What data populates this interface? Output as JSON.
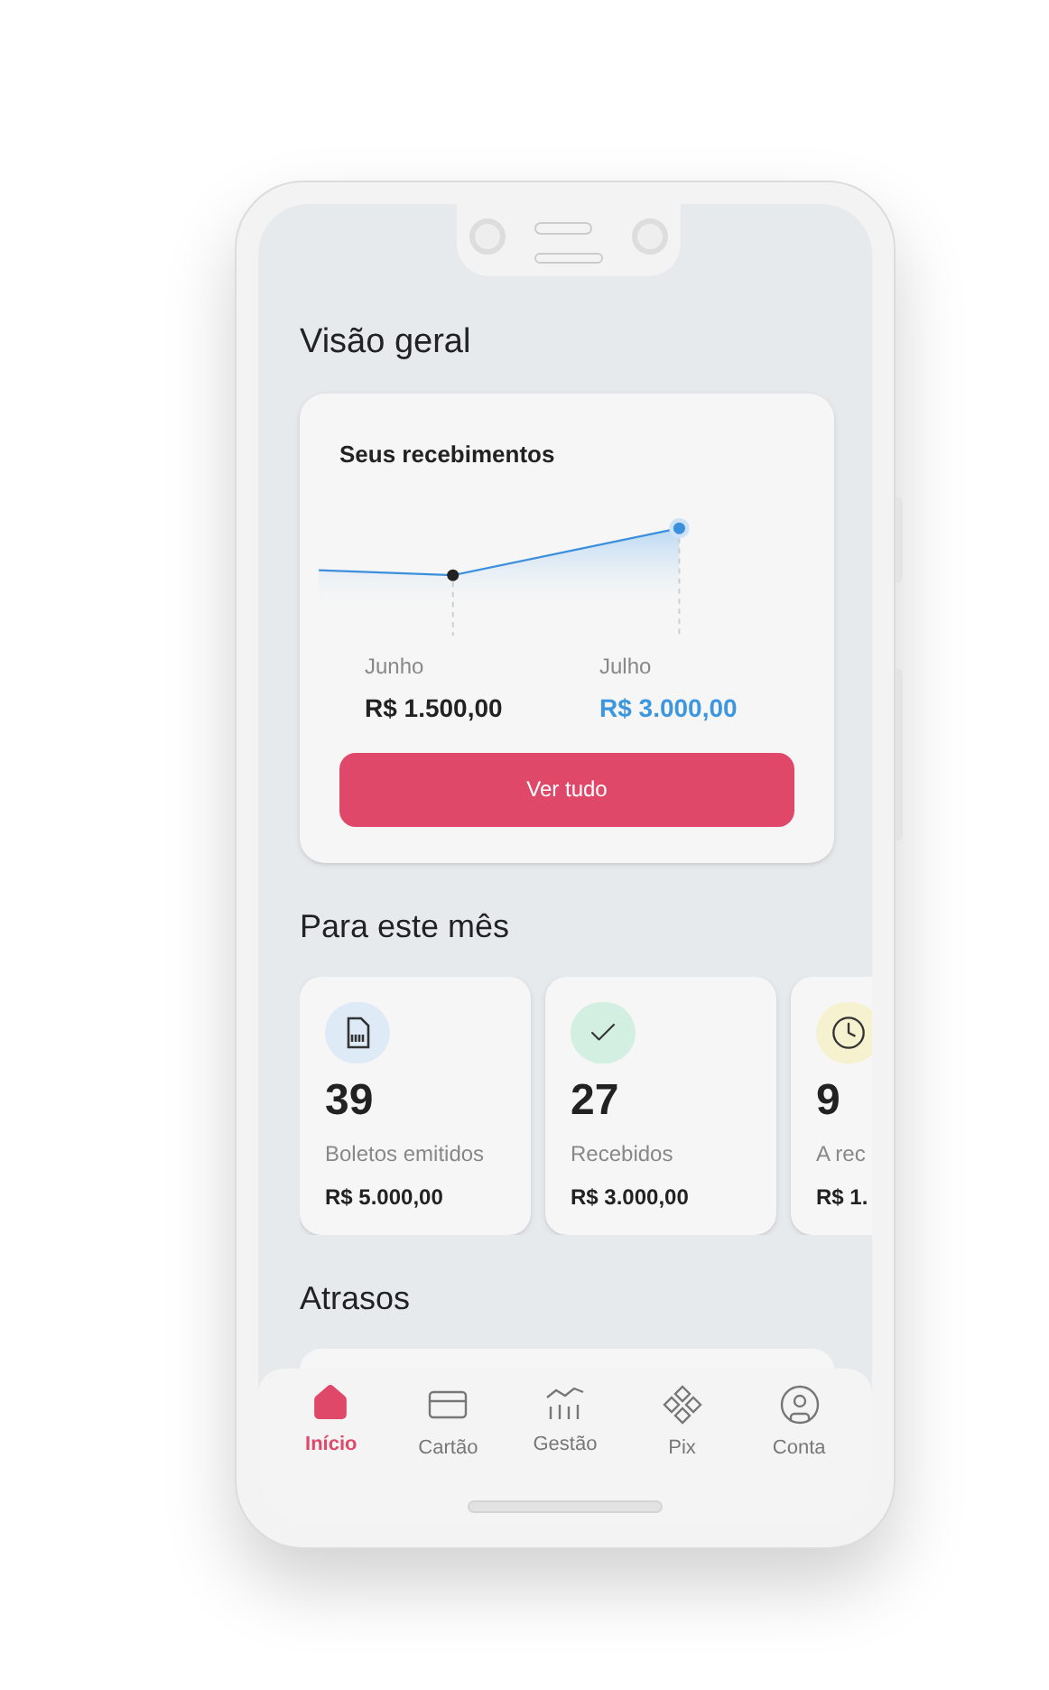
{
  "screen": {
    "title": "Visão geral"
  },
  "receipts_card": {
    "title": "Seus recebimentos",
    "months": [
      {
        "label": "Junho",
        "amount": "R$ 1.500,00",
        "selected": false
      },
      {
        "label": "Julho",
        "amount": "R$ 3.000,00",
        "selected": true
      }
    ],
    "button": "Ver tudo"
  },
  "month_section": {
    "title": "Para este mês",
    "cards": [
      {
        "kind": "boleto",
        "count": "39",
        "label": "Boletos emitidos",
        "amount": "R$ 5.000,00"
      },
      {
        "kind": "received",
        "count": "27",
        "label": "Recebidos",
        "amount": "R$ 3.000,00"
      },
      {
        "kind": "pending",
        "count": "9",
        "label": "A rec",
        "amount": "R$ 1."
      }
    ]
  },
  "late_section": {
    "title": "Atrasos"
  },
  "bottom_nav": [
    {
      "kind": "home",
      "label": "Início",
      "selected": true
    },
    {
      "kind": "card",
      "label": "Cartão",
      "selected": false
    },
    {
      "kind": "chart",
      "label": "Gestão",
      "selected": false
    },
    {
      "kind": "pix",
      "label": "Pix",
      "selected": false
    },
    {
      "kind": "account",
      "label": "Conta",
      "selected": false
    }
  ]
}
